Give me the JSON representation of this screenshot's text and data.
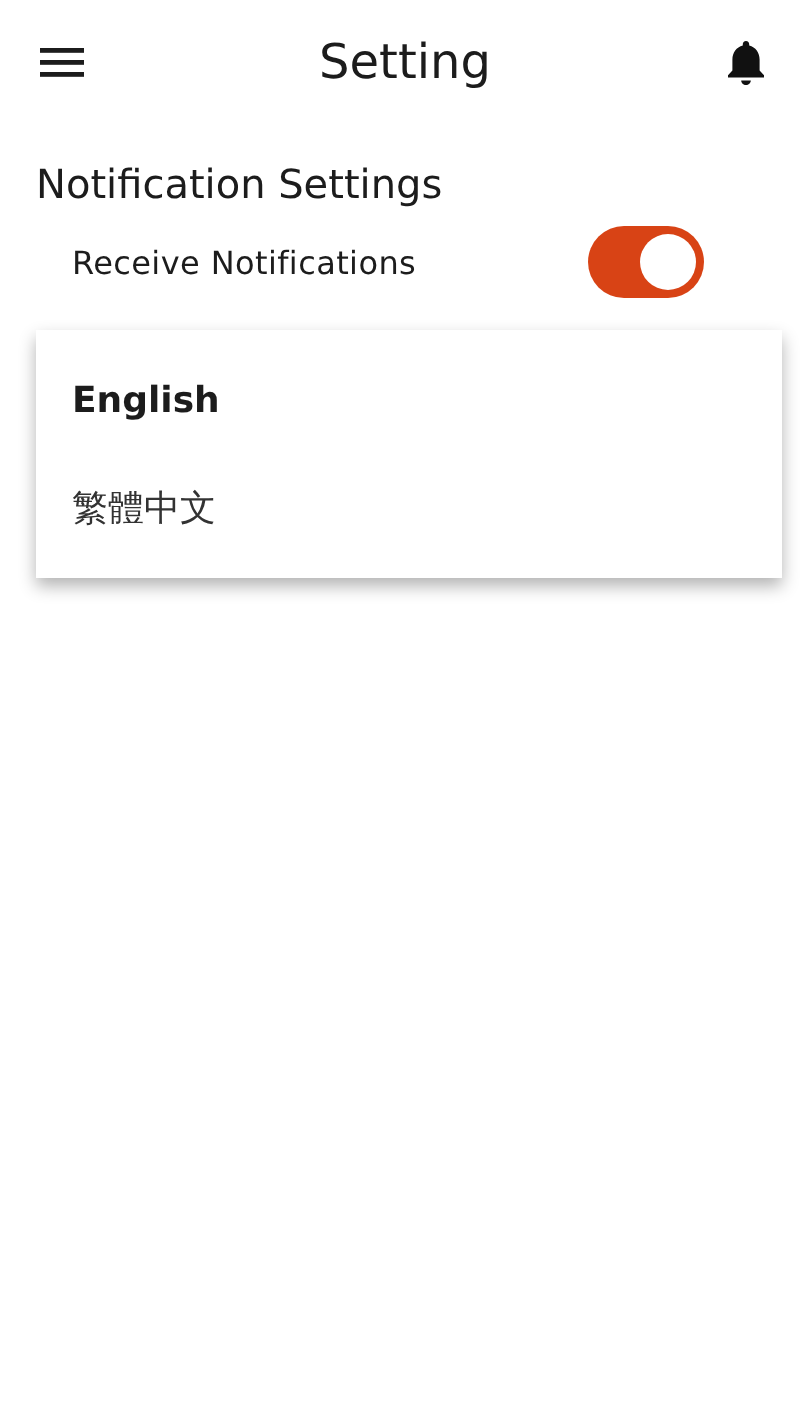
{
  "header": {
    "title": "Setting"
  },
  "section": {
    "title": "Notification Settings"
  },
  "settings": [
    {
      "label": "Receive Notifications",
      "on": true
    }
  ],
  "language_menu": [
    {
      "label": "English",
      "selected": true
    },
    {
      "label": "繁體中文",
      "selected": false
    }
  ]
}
